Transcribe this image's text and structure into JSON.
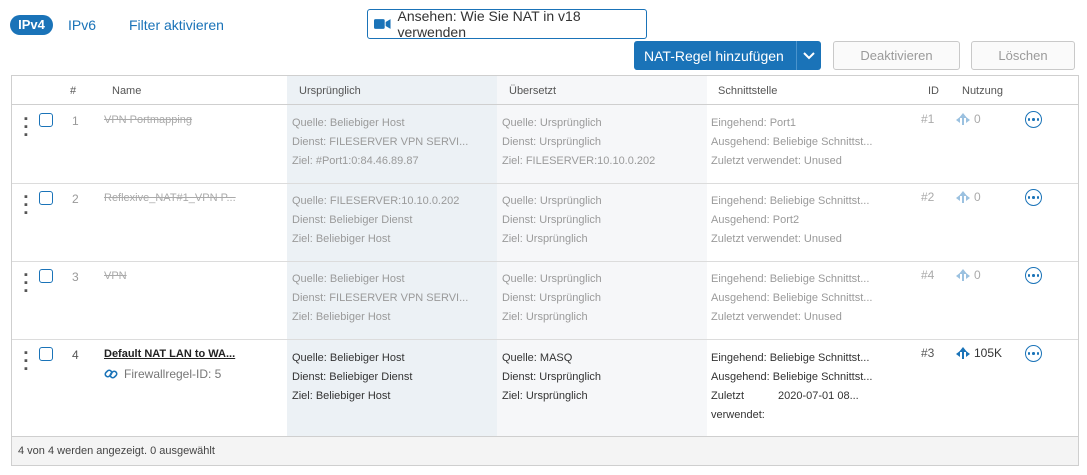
{
  "top": {
    "tab_ipv4": "IPv4",
    "tab_ipv6": "IPv6",
    "filter_link": "Filter aktivieren",
    "video_button": "Ansehen: Wie Sie NAT in v18 verwenden",
    "add_button": "NAT-Regel hinzufügen",
    "deactivate_button": "Deaktivieren",
    "delete_button": "Löschen"
  },
  "table": {
    "headers": {
      "num": "#",
      "name": "Name",
      "original": "Ursprünglich",
      "translated": "Übersetzt",
      "interface": "Schnittstelle",
      "id": "ID",
      "usage": "Nutzung"
    },
    "rows": [
      {
        "num": "1",
        "name": "VPN Portmapping",
        "original": [
          "Quelle: Beliebiger Host",
          "Dienst: FILESERVER VPN SERVI...",
          "Ziel: #Port1:0:84.46.89.87"
        ],
        "translated": [
          "Quelle: Ursprünglich",
          "Dienst: Ursprünglich",
          "Ziel: FILESERVER:10.10.0.202"
        ],
        "interface": [
          "Eingehend: Port1",
          "Ausgehend: Beliebige Schnittst...",
          "Zuletzt verwendet: Unused"
        ],
        "id": "#1",
        "usage": "0"
      },
      {
        "num": "2",
        "name": "Reflexive_NAT#1_VPN P...",
        "original": [
          "Quelle: FILESERVER:10.10.0.202",
          "Dienst: Beliebiger Dienst",
          "Ziel: Beliebiger Host"
        ],
        "translated": [
          "Quelle: Ursprünglich",
          "Dienst: Ursprünglich",
          "Ziel: Ursprünglich"
        ],
        "interface": [
          "Eingehend: Beliebige Schnittst...",
          "Ausgehend: Port2",
          "Zuletzt verwendet: Unused"
        ],
        "id": "#2",
        "usage": "0"
      },
      {
        "num": "3",
        "name": "VPN",
        "original": [
          "Quelle: Beliebiger Host",
          "Dienst: FILESERVER VPN SERVI...",
          "Ziel: Beliebiger Host"
        ],
        "translated": [
          "Quelle: Ursprünglich",
          "Dienst: Ursprünglich",
          "Ziel: Ursprünglich"
        ],
        "interface": [
          "Eingehend: Beliebige Schnittst...",
          "Ausgehend: Beliebige Schnittst...",
          "Zuletzt verwendet: Unused"
        ],
        "id": "#4",
        "usage": "0"
      },
      {
        "num": "4",
        "name": "Default NAT LAN to WA...",
        "firewall_rule": "Firewallregel-ID: 5",
        "original": [
          "Quelle: Beliebiger Host",
          "Dienst: Beliebiger Dienst",
          "Ziel: Beliebiger Host"
        ],
        "translated": [
          "Quelle: MASQ",
          "Dienst: Ursprünglich",
          "Ziel: Ursprünglich"
        ],
        "interface": [
          "Eingehend: Beliebige Schnittst...",
          "Ausgehend: Beliebige Schnittst...",
          "Zuletzt",
          "verwendet:"
        ],
        "last_used_value": "2020-07-01 08...",
        "id": "#3",
        "usage": "105K"
      }
    ]
  },
  "footer": {
    "status": "4 von 4 werden angezeigt. 0 ausgewählt"
  },
  "colors": {
    "accent": "#1a73b8",
    "original_col": "#ecf1f5",
    "translated_col": "#f6f7f9"
  }
}
